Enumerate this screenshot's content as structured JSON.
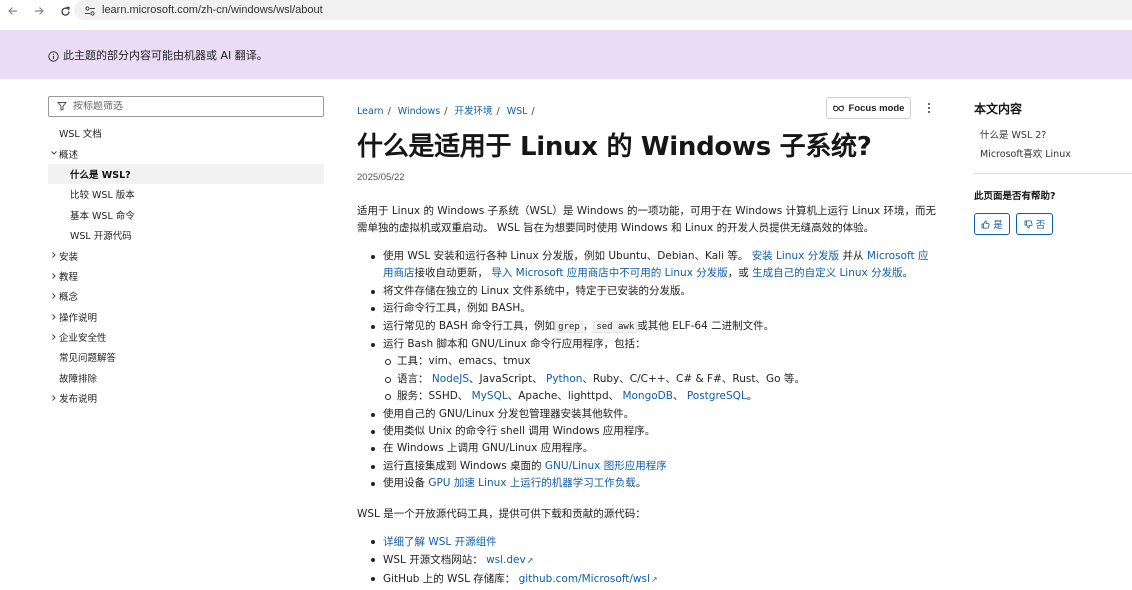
{
  "browser": {
    "url": "learn.microsoft.com/zh-cn/windows/wsl/about"
  },
  "banner": {
    "text": "此主题的部分内容可能由机器或 AI 翻译。"
  },
  "sidebar": {
    "filter_placeholder": "按标题筛选",
    "items": [
      {
        "label": "WSL 文档"
      },
      {
        "label": "概述"
      },
      {
        "label": "什么是 WSL?"
      },
      {
        "label": "比较 WSL 版本"
      },
      {
        "label": "基本 WSL 命令"
      },
      {
        "label": "WSL 开源代码"
      },
      {
        "label": "安装"
      },
      {
        "label": "教程"
      },
      {
        "label": "概念"
      },
      {
        "label": "操作说明"
      },
      {
        "label": "企业安全性"
      },
      {
        "label": "常见问题解答"
      },
      {
        "label": "故障排除"
      },
      {
        "label": "发布说明"
      }
    ]
  },
  "breadcrumb": [
    "Learn",
    "Windows",
    "开发环境",
    "WSL"
  ],
  "focus_mode_label": "Focus mode",
  "article": {
    "title": "什么是适用于 Linux 的 Windows 子系统?",
    "date": "2025/05/22",
    "intro": "适用于 Linux 的 Windows 子系统（WSL）是 Windows 的一项功能，可用于在 Windows 计算机上运行 Linux 环境，而无需单独的虚拟机或双重启动。 WSL 旨在为想要同时使用 Windows 和 Linux 的开发人员提供无缝高效的体验。",
    "b1_text1": "使用 WSL 安装和运行各种 Linux 分发版，例如 Ubuntu、Debian、Kali 等。",
    "b1_link1": "安装 Linux 分发版",
    "b1_text2": "并从",
    "b1_link2": "Microsoft 应用商店",
    "b1_text3": "接收自动更新，",
    "b1_link3": "导入 Microsoft 应用商店中不可用的 Linux 分发版",
    "b1_text4": "，或",
    "b1_link4": "生成自己的自定义 Linux 分发版",
    "b1_text5": "。",
    "b2": "将文件存储在独立的 Linux 文件系统中，特定于已安装的分发版。",
    "b3": "运行命令行工具，例如 BASH。",
    "b4_text1": "运行常见的 BASH 命令行工具，例如",
    "b4_code1": "grep",
    "b4_text2": "，",
    "b4_code2": "sed awk",
    "b4_text3": "或其他 ELF-64 二进制文件。",
    "b5": "运行 Bash 脚本和 GNU/Linux 命令行应用程序，包括：",
    "s1": "工具：vim、emacs、tmux",
    "s2_text1": "语言：",
    "s2_link1": "NodeJS",
    "s2_text2": "、JavaScript、",
    "s2_link2": "Python",
    "s2_text3": "、Ruby、C/C++、C# & F#、Rust、Go 等。",
    "s3_text1": "服务：SSHD、",
    "s3_link1": "MySQL",
    "s3_text2": "、Apache、lighttpd、",
    "s3_link2": "MongoDB",
    "s3_text3": "、",
    "s3_link3": "PostgreSQL",
    "s3_text4": "。",
    "b6": "使用自己的 GNU/Linux 分发包管理器安装其他软件。",
    "b7": "使用类似 Unix 的命令行 shell 调用 Windows 应用程序。",
    "b8": "在 Windows 上调用 GNU/Linux 应用程序。",
    "b9_text": "运行直接集成到 Windows 桌面的",
    "b9_link": "GNU/Linux 图形应用程序",
    "b10_text": "使用设备",
    "b10_link": "GPU 加速 Linux 上运行的机器学习工作负载",
    "b10_end": "。",
    "para2": "WSL 是一个开放源代码工具，提供可供下载和贡献的源代码：",
    "l1_link": "详细了解 WSL 开源组件",
    "l2_text": "WSL 开源文档网站：",
    "l2_link": "wsl.dev",
    "l3_text": "GitHub 上的 WSL 存储库：",
    "l3_link": "github.com/Microsoft/wsl"
  },
  "right_rail": {
    "heading": "本文内容",
    "items": [
      "什么是 WSL 2?",
      "Microsoft喜欢 Linux"
    ],
    "helpful_question": "此页面是否有帮助?",
    "yes": "是",
    "no": "否"
  },
  "colors": {
    "link": "#0f5ea8",
    "banner_bg": "#eadcf4"
  }
}
